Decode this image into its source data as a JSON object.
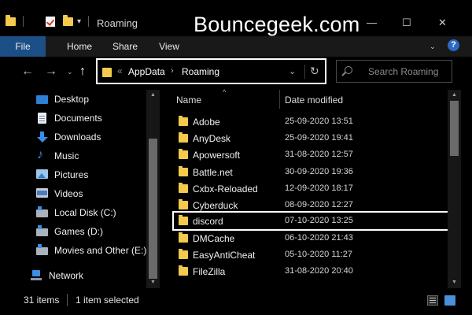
{
  "window": {
    "title": "Roaming",
    "brand_watermark": "Bouncegeek.com",
    "minimize_glyph": "—",
    "maximize_glyph": "☐",
    "close_glyph": "✕",
    "quick_access_dropdown": "▾"
  },
  "ribbon": {
    "tabs": [
      "File",
      "Home",
      "Share",
      "View"
    ],
    "active_tab": "File",
    "expand_glyph": "⌄",
    "help_label": "?",
    "accent_color": "#1c4f86"
  },
  "navigation": {
    "back_glyph": "←",
    "forward_glyph": "→",
    "recent_glyph": "⌄",
    "up_glyph": "↑"
  },
  "address_bar": {
    "prefix": "«",
    "crumbs": [
      "AppData",
      "Roaming"
    ],
    "separator": "›",
    "dropdown_glyph": "⌄",
    "refresh_glyph": "↻"
  },
  "search": {
    "placeholder": "Search Roaming",
    "value": ""
  },
  "nav_pane": {
    "items": [
      {
        "label": "Desktop",
        "icon": "desktop-icon"
      },
      {
        "label": "Documents",
        "icon": "documents-icon"
      },
      {
        "label": "Downloads",
        "icon": "downloads-icon"
      },
      {
        "label": "Music",
        "icon": "music-icon"
      },
      {
        "label": "Pictures",
        "icon": "pictures-icon"
      },
      {
        "label": "Videos",
        "icon": "videos-icon"
      },
      {
        "label": "Local Disk (C:)",
        "icon": "drive-icon"
      },
      {
        "label": "Games (D:)",
        "icon": "drive-icon"
      },
      {
        "label": "Movies and Other (E:)",
        "icon": "drive-icon"
      },
      {
        "label": "Network",
        "icon": "network-icon"
      }
    ]
  },
  "file_list": {
    "columns": [
      "Name",
      "Date modified"
    ],
    "sort_indicator": "^",
    "rows": [
      {
        "name": "Adobe",
        "date": "25-09-2020 13:51"
      },
      {
        "name": "AnyDesk",
        "date": "25-09-2020 19:41"
      },
      {
        "name": "Apowersoft",
        "date": "31-08-2020 12:57"
      },
      {
        "name": "Battle.net",
        "date": "30-09-2020 19:36"
      },
      {
        "name": "Cxbx-Reloaded",
        "date": "12-09-2020 18:17"
      },
      {
        "name": "Cyberduck",
        "date": "08-09-2020 12:27"
      },
      {
        "name": "discord",
        "date": "07-10-2020 13:25",
        "highlighted": true
      },
      {
        "name": "DMCache",
        "date": "06-10-2020 21:43"
      },
      {
        "name": "EasyAntiCheat",
        "date": "05-10-2020 11:27"
      },
      {
        "name": "FileZilla",
        "date": "31-08-2020 20:40"
      }
    ]
  },
  "scrollbars": {
    "up_glyph": "▲",
    "down_glyph": "▼"
  },
  "status_bar": {
    "item_count": "31 items",
    "selection": "1 item selected"
  }
}
